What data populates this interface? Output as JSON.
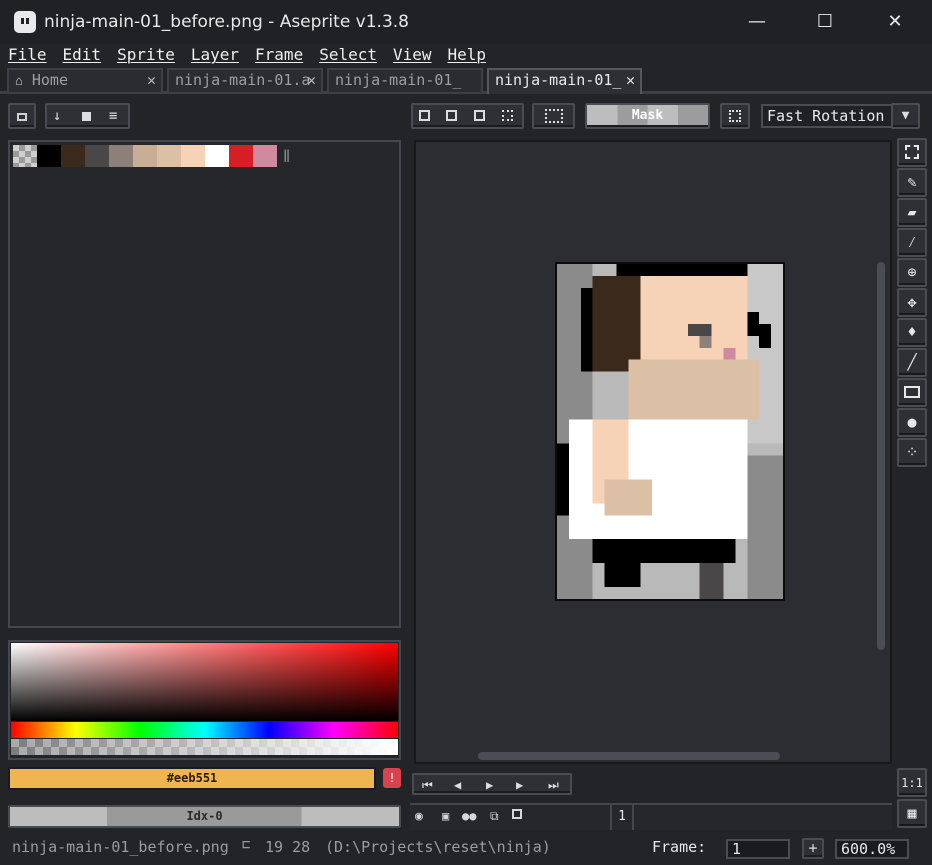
{
  "window": {
    "title": "ninja-main-01_before.png - Aseprite v1.3.8",
    "minimize_glyph": "—",
    "maximize_glyph": "☐",
    "close_glyph": "✕"
  },
  "menu": [
    "File",
    "Edit",
    "Sprite",
    "Layer",
    "Frame",
    "Select",
    "View",
    "Help"
  ],
  "tabs": [
    {
      "label": "Home",
      "close": "✕"
    },
    {
      "label": "ninja-main-01.a",
      "close": "✕"
    },
    {
      "label": "ninja-main-01_",
      "close": "✕"
    },
    {
      "label": "ninja-main-01_",
      "close": "✕"
    }
  ],
  "palette": {
    "colors": [
      "#000000",
      "#3b2a1c",
      "#4a4748",
      "#8c8078",
      "#c9ad97",
      "#dcc0a6",
      "#f6d2b6",
      "#ffffff",
      "#d81e25",
      "#cf8a9f"
    ]
  },
  "toolbar": {
    "mask_label": "Mask",
    "rotation_mode": "Fast Rotation"
  },
  "color_bar": {
    "fg_hex": "#eeb551",
    "fg_color": "#eeb551",
    "index_label": "Idx-0"
  },
  "timeline": {
    "frame_number": "1"
  },
  "status": {
    "filename": "ninja-main-01_before.png",
    "coords": "19 28",
    "path": "(D:\\Projects\\reset\\ninja)",
    "frame_label": "Frame:",
    "frame_value": "1",
    "zoom": "600.0%"
  },
  "accent_colors": {
    "title_bg": "#202124",
    "panel_bg": "#26272b",
    "fg_swatch": "#eeb551",
    "warn": "#d9434f"
  }
}
